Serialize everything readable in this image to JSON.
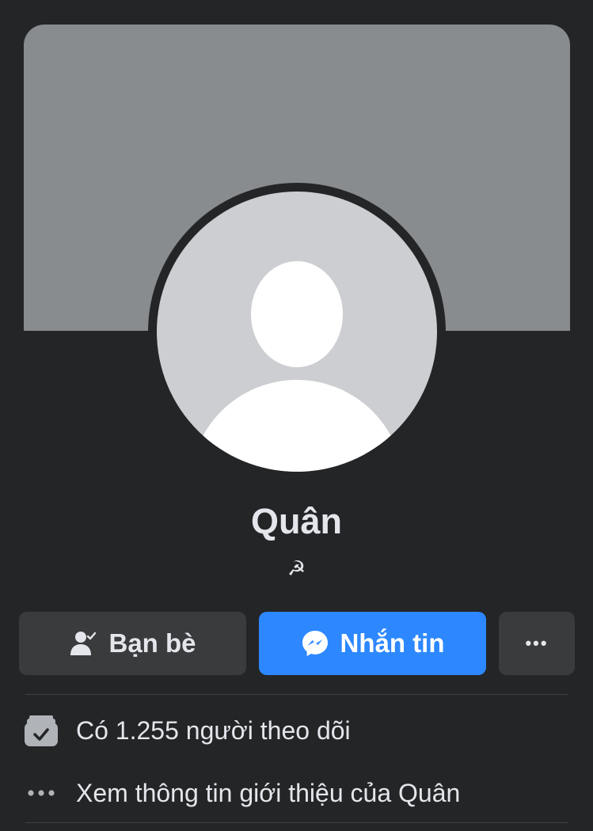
{
  "profile": {
    "name": "Quân",
    "bio": "☭"
  },
  "actions": {
    "friends_label": "Bạn bè",
    "message_label": "Nhắn tin",
    "more_label": "•••"
  },
  "details": [
    {
      "icon": "followers-icon",
      "text": "Có 1.255 người theo dõi"
    },
    {
      "icon": "more-dots-icon",
      "text": "Xem thông tin giới thiệu của Quân"
    }
  ],
  "colors": {
    "background": "#242527",
    "cover": "#898c8f",
    "avatar_bg": "#cdced2",
    "button_secondary": "#3a3b3d",
    "button_primary": "#2d88ff",
    "text": "#e4e6eb"
  }
}
